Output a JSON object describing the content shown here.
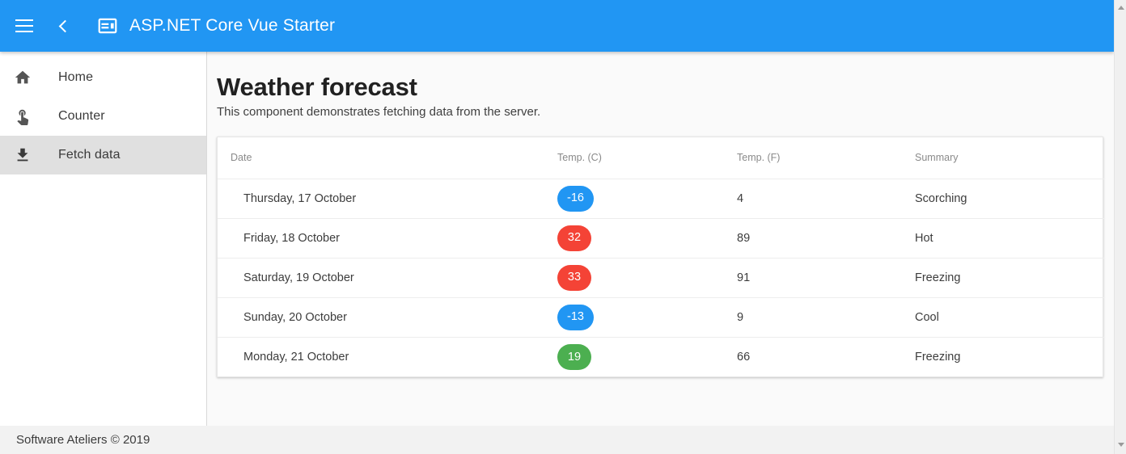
{
  "appbar": {
    "menu_icon": "hamburger-menu-icon",
    "back_icon": "chevron-left-icon",
    "brand_icon": "web-asset-icon",
    "title": "ASP.NET Core Vue Starter"
  },
  "sidebar": {
    "items": [
      {
        "label": "Home",
        "icon": "home-icon",
        "active": false
      },
      {
        "label": "Counter",
        "icon": "touch-app-icon",
        "active": false
      },
      {
        "label": "Fetch data",
        "icon": "download-icon",
        "active": true
      }
    ]
  },
  "main": {
    "title": "Weather forecast",
    "subtitle": "This component demonstrates fetching data from the server.",
    "table": {
      "headers": [
        "Date",
        "Temp. (C)",
        "Temp. (F)",
        "Summary"
      ],
      "rows": [
        {
          "date": "Thursday, 17 October",
          "tempC": "-16",
          "tempF": "4",
          "summary": "Scorching",
          "badge_color": "#2196f3"
        },
        {
          "date": "Friday, 18 October",
          "tempC": "32",
          "tempF": "89",
          "summary": "Hot",
          "badge_color": "#f44336"
        },
        {
          "date": "Saturday, 19 October",
          "tempC": "33",
          "tempF": "91",
          "summary": "Freezing",
          "badge_color": "#f44336"
        },
        {
          "date": "Sunday, 20 October",
          "tempC": "-13",
          "tempF": "9",
          "summary": "Cool",
          "badge_color": "#2196f3"
        },
        {
          "date": "Monday, 21 October",
          "tempC": "19",
          "tempF": "66",
          "summary": "Freezing",
          "badge_color": "#4caf50"
        }
      ]
    }
  },
  "footer": {
    "text": "Software Ateliers © 2019"
  },
  "colors": {
    "primary": "#2196f3",
    "hot": "#f44336",
    "mild": "#4caf50",
    "cold": "#2196f3",
    "active_nav": "#e0e0e0"
  }
}
